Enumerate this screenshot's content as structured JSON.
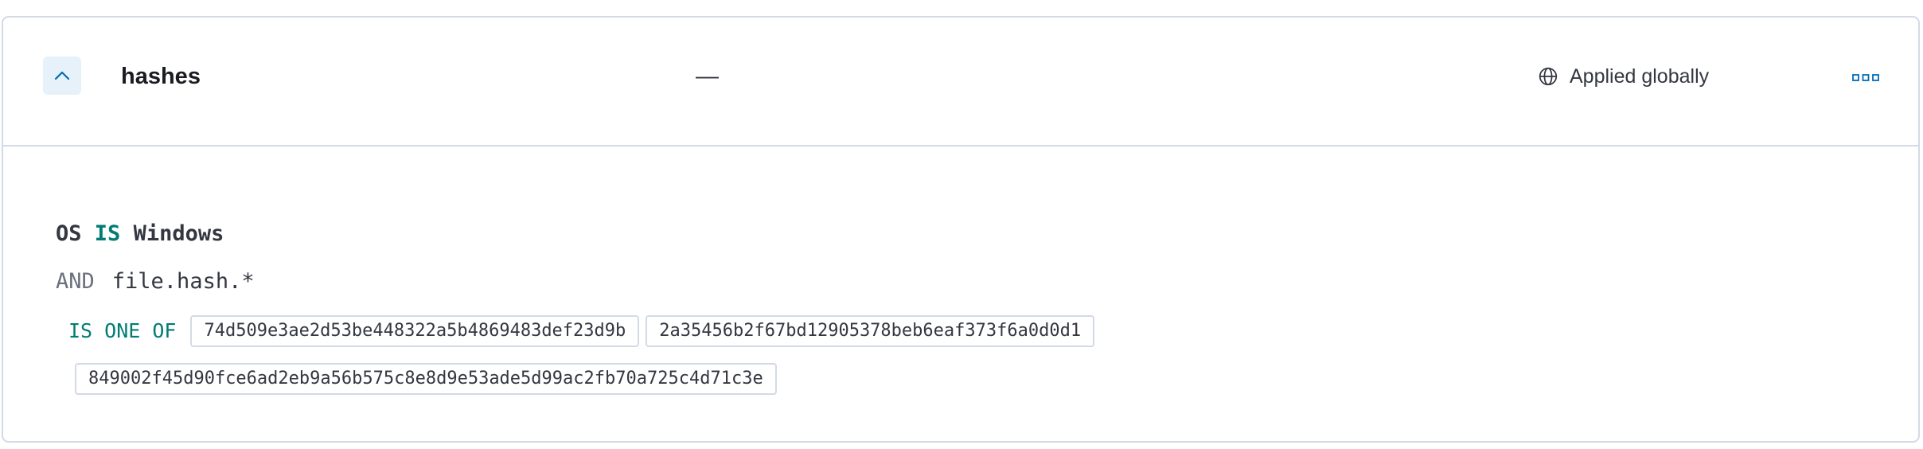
{
  "exception": {
    "name": "hashes",
    "separator": "—",
    "scope_label": "Applied globally",
    "icons": {
      "toggle": "chevron-up-icon",
      "scope": "globe-icon",
      "actions": "boxes-horizontal-icon"
    },
    "colors": {
      "toggle_bg": "#e6f1fa",
      "accent": "#006bb8",
      "operator_green": "#017d73",
      "border": "#d3dae6"
    }
  },
  "conditions": {
    "line1": {
      "field": "OS",
      "operator": "IS",
      "value": "Windows"
    },
    "line2": {
      "conjunction": "AND",
      "field": "file.hash.*"
    },
    "line3": {
      "operator": "IS ONE OF",
      "values": [
        "74d509e3ae2d53be448322a5b4869483def23d9b",
        "2a35456b2f67bd12905378beb6eaf373f6a0d0d1",
        "849002f45d90fce6ad2eb9a56b575c8e8d9e53ade5d99ac2fb70a725c4d71c3e"
      ]
    }
  }
}
